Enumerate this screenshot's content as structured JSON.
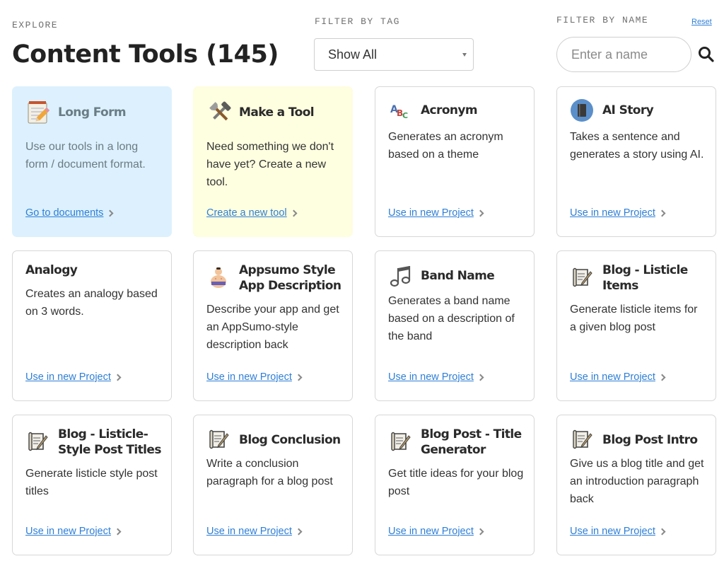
{
  "header": {
    "eyebrow": "EXPLORE",
    "title": "Content Tools (145)"
  },
  "filters": {
    "tag_label": "FILTER BY TAG",
    "tag_selected": "Show All",
    "name_label": "FILTER BY NAME",
    "name_placeholder": "Enter a name",
    "reset_label": "Reset"
  },
  "cards": [
    {
      "title": "Long Form",
      "icon": "notepad-pencil-icon",
      "desc": "Use our tools in a long form / document format.",
      "link": "Go to documents"
    },
    {
      "title": "Make a Tool",
      "icon": "tools-icon",
      "desc": "Need something we don't have yet? Create a new tool.",
      "link": "Create a new tool"
    },
    {
      "title": "Acronym",
      "icon": "abc-icon",
      "desc": "Generates an acronym based on a theme",
      "link": "Use in new Project"
    },
    {
      "title": "AI Story",
      "icon": "book-icon",
      "desc": "Takes a sentence and generates a story using AI.",
      "link": "Use in new Project"
    },
    {
      "title": "Analogy",
      "icon": "",
      "desc": "Creates an analogy based on 3 words.",
      "link": "Use in new Project"
    },
    {
      "title": "Appsumo Style App Description",
      "icon": "sumo-wrestler-icon",
      "desc": "Describe your app and get an AppSumo-style description back",
      "link": "Use in new Project"
    },
    {
      "title": "Band Name",
      "icon": "music-notes-icon",
      "desc": "Generates a band name based on a description of the band",
      "link": "Use in new Project"
    },
    {
      "title": "Blog - Listicle Items",
      "icon": "scroll-quill-icon",
      "desc": "Generate listicle items for a given blog post",
      "link": "Use in new Project"
    },
    {
      "title": "Blog - Listicle-Style Post Titles",
      "icon": "scroll-quill-icon",
      "desc": "Generate listicle style post titles",
      "link": "Use in new Project"
    },
    {
      "title": "Blog Conclusion",
      "icon": "scroll-quill-icon",
      "desc": "Write a conclusion paragraph for a blog post",
      "link": "Use in new Project"
    },
    {
      "title": "Blog Post - Title Generator",
      "icon": "scroll-quill-icon",
      "desc": "Get title ideas for your blog post",
      "link": "Use in new Project"
    },
    {
      "title": "Blog Post Intro",
      "icon": "scroll-quill-icon",
      "desc": "Give us a blog title and get an introduction paragraph back",
      "link": "Use in new Project"
    }
  ],
  "colors": {
    "link": "#2f7fd6",
    "card_blue": "#dcf1fd",
    "card_yellow": "#fefee0",
    "border": "#d7d7d7"
  }
}
